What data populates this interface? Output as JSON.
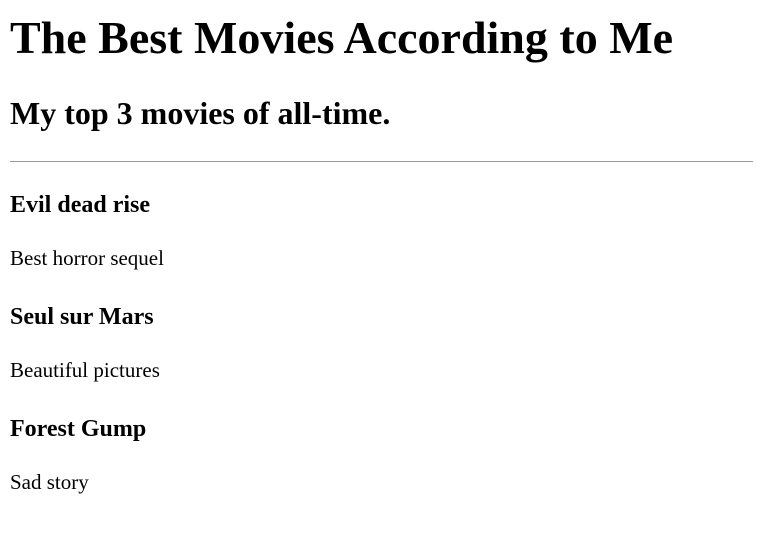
{
  "header": {
    "title": "The Best Movies According to Me",
    "subtitle": "My top 3 movies of all-time."
  },
  "movies": [
    {
      "title": "Evil dead rise",
      "description": "Best horror sequel"
    },
    {
      "title": "Seul sur Mars",
      "description": "Beautiful pictures"
    },
    {
      "title": "Forest Gump",
      "description": "Sad story"
    }
  ]
}
